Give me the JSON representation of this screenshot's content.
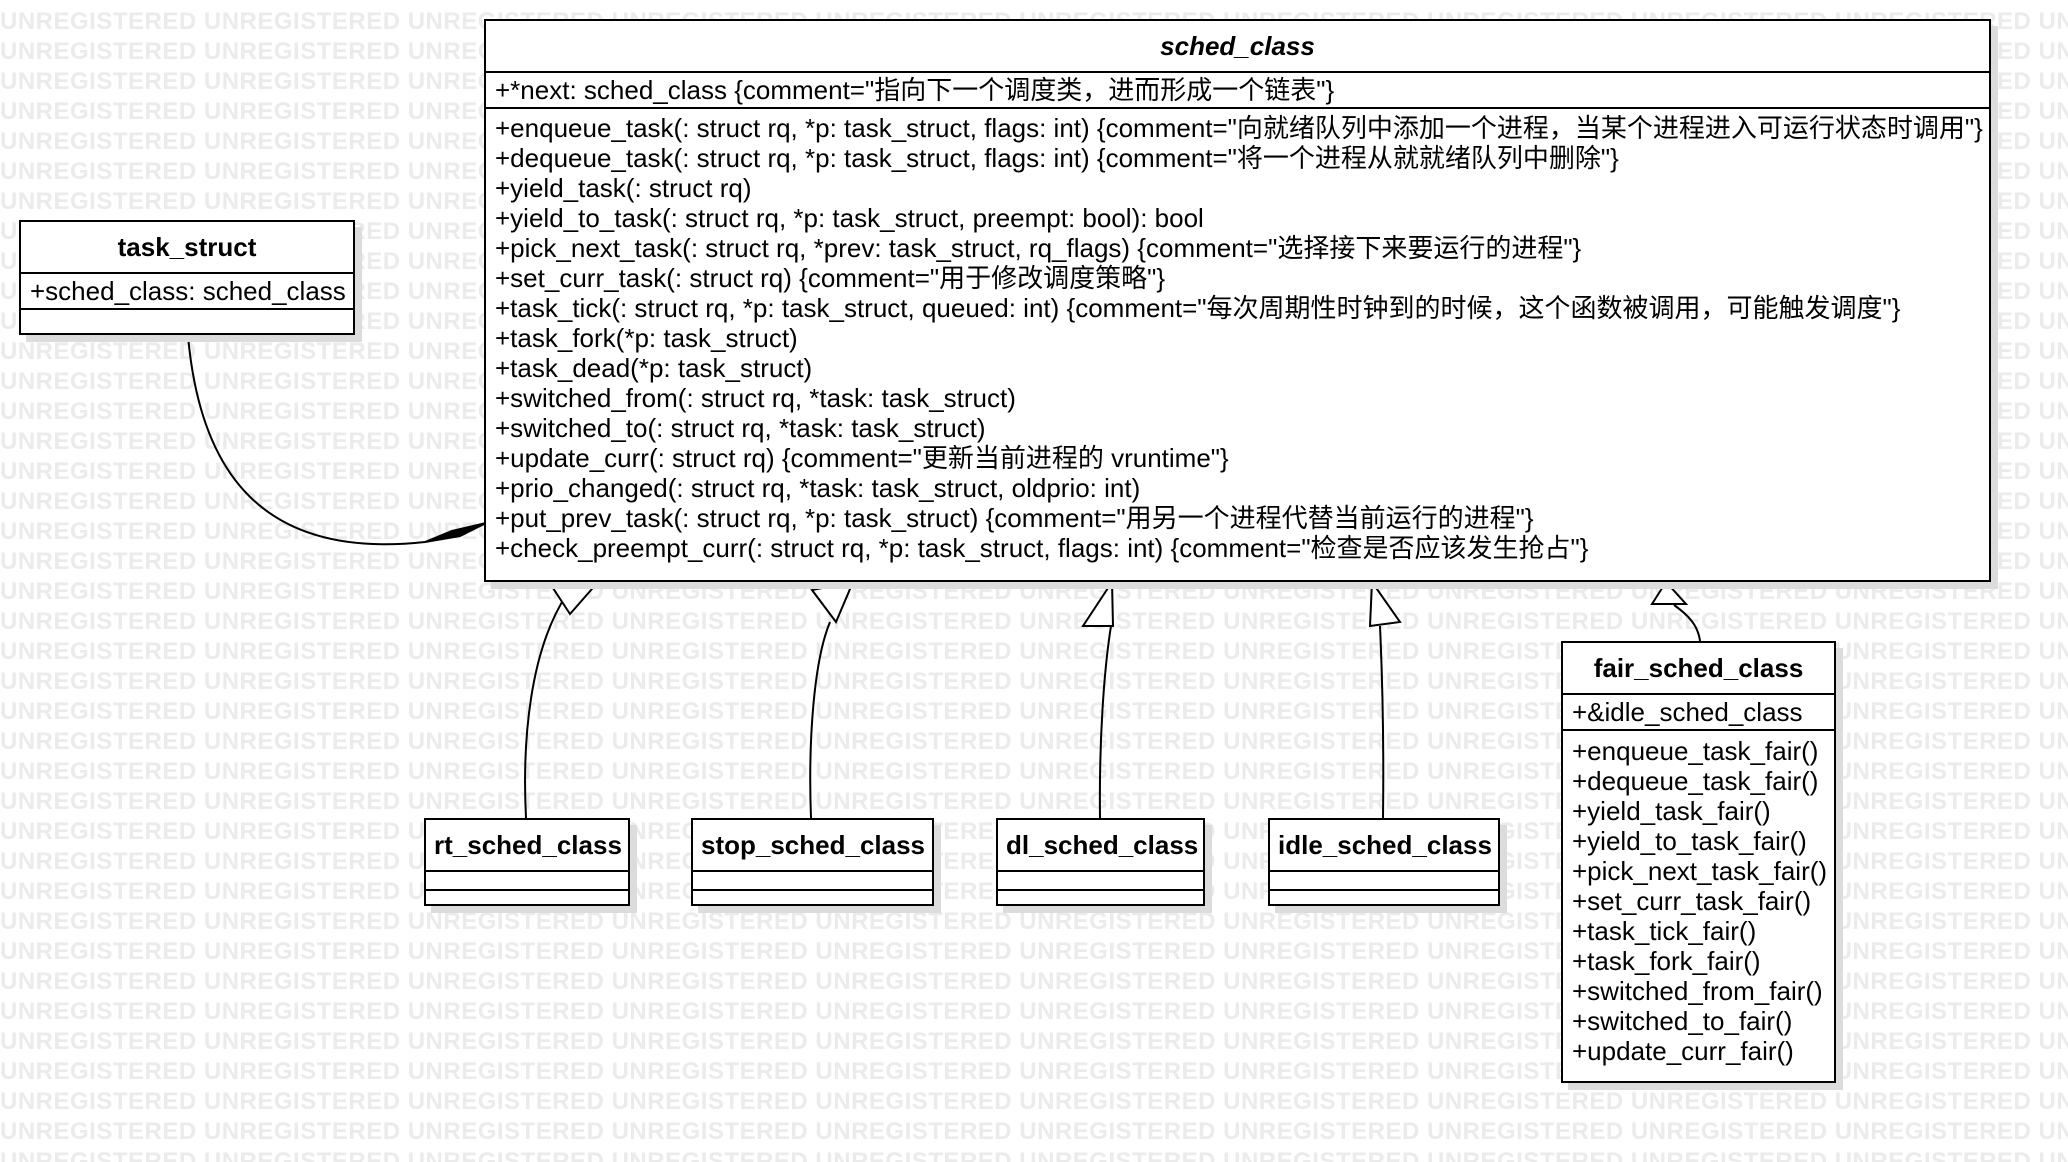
{
  "watermark_text": "UNREGISTERED",
  "sched_class": {
    "name": "sched_class",
    "attributes": [
      "+*next: sched_class {comment=\"指向下一个调度类，进而形成一个链表\"}"
    ],
    "operations": [
      "+enqueue_task(: struct rq, *p: task_struct, flags: int) {comment=\"向就绪队列中添加一个进程，当某个进程进入可运行状态时调用\"}",
      "+dequeue_task(: struct rq, *p: task_struct, flags: int) {comment=\"将一个进程从就就绪队列中删除\"}",
      "+yield_task(: struct rq)",
      "+yield_to_task(: struct rq, *p: task_struct, preempt: bool): bool",
      "+pick_next_task(: struct rq, *prev: task_struct, rq_flags) {comment=\"选择接下来要运行的进程\"}",
      "+set_curr_task(: struct rq) {comment=\"用于修改调度策略\"}",
      "+task_tick(: struct rq, *p: task_struct, queued: int) {comment=\"每次周期性时钟到的时候，这个函数被调用，可能触发调度\"}",
      "+task_fork(*p: task_struct)",
      "+task_dead(*p: task_struct)",
      "+switched_from(: struct rq, *task: task_struct)",
      "+switched_to(: struct rq, *task: task_struct)",
      "+update_curr(: struct rq) {comment=\"更新当前进程的 vruntime\"}",
      "+prio_changed(: struct rq, *task: task_struct, oldprio: int)",
      "+put_prev_task(: struct rq, *p: task_struct) {comment=\"用另一个进程代替当前运行的进程\"}",
      "+check_preempt_curr(: struct rq, *p: task_struct, flags: int) {comment=\"检查是否应该发生抢占\"}"
    ]
  },
  "task_struct": {
    "name": "task_struct",
    "attributes": [
      "+sched_class: sched_class"
    ]
  },
  "rt_sched_class": {
    "name": "rt_sched_class"
  },
  "stop_sched_class": {
    "name": "stop_sched_class"
  },
  "dl_sched_class": {
    "name": "dl_sched_class"
  },
  "idle_sched_class": {
    "name": "idle_sched_class"
  },
  "fair_sched_class": {
    "name": "fair_sched_class",
    "attributes": [
      "+&idle_sched_class"
    ],
    "operations": [
      "+enqueue_task_fair()",
      "+dequeue_task_fair()",
      "+yield_task_fair()",
      "+yield_to_task_fair()",
      "+pick_next_task_fair()",
      "+set_curr_task_fair()",
      "+task_tick_fair()",
      "+task_fork_fair()",
      "+switched_from_fair()",
      "+switched_to_fair()",
      "+update_curr_fair()"
    ]
  }
}
